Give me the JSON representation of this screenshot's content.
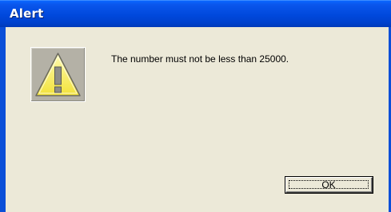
{
  "window": {
    "title": "Alert"
  },
  "dialog": {
    "icon": "warning-icon",
    "message": "The number must not be less than 25000.",
    "ok_label": "OK"
  },
  "colors": {
    "titlebar": "#0048dc",
    "client_background": "#ece9d8",
    "warning_yellow": "#fff36b"
  }
}
